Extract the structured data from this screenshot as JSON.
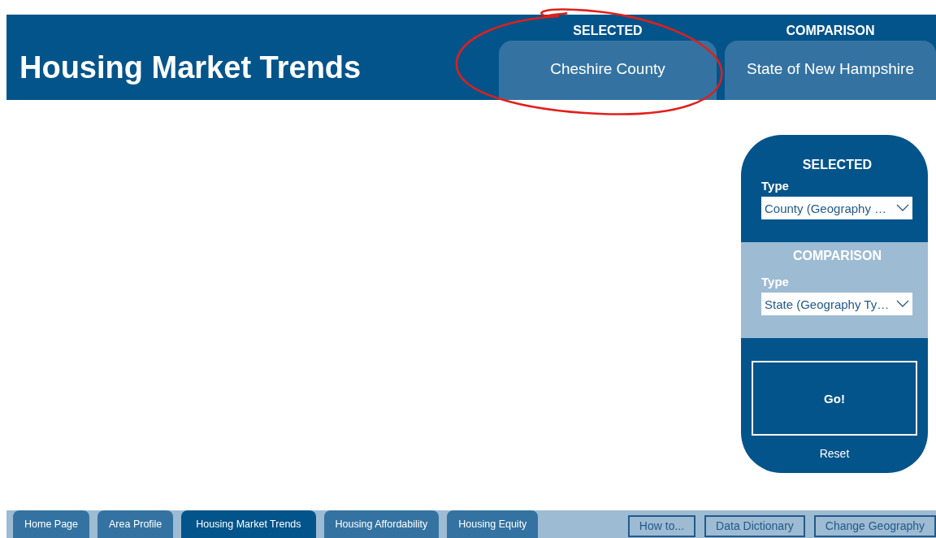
{
  "header": {
    "title": "Housing Market Trends",
    "areas": [
      {
        "label": "SELECTED",
        "value": "Cheshire County",
        "highlighted": true
      },
      {
        "label": "COMPARISON",
        "value": "State of New Hampshire",
        "highlighted": false
      }
    ]
  },
  "panel": {
    "sections": [
      {
        "kind": "dark",
        "heading": "SELECTED",
        "field_label": "Type",
        "dropdown": "County (Geography …"
      },
      {
        "kind": "light",
        "heading": "COMPARISON",
        "field_label": "Type",
        "dropdown": "State (Geography Ty…"
      }
    ],
    "go_button": "Go!",
    "reset": "Reset"
  },
  "nav": {
    "tabs": [
      {
        "label": "Home Page",
        "selected": false
      },
      {
        "label": "Area Profile",
        "selected": false
      },
      {
        "label": "Housing Market Trends",
        "selected": true
      },
      {
        "label": "Housing Affordability",
        "selected": false
      },
      {
        "label": "Housing Equity",
        "selected": false
      }
    ],
    "buttons": [
      "How to...",
      "Data Dictionary",
      "Change Geography"
    ]
  }
}
